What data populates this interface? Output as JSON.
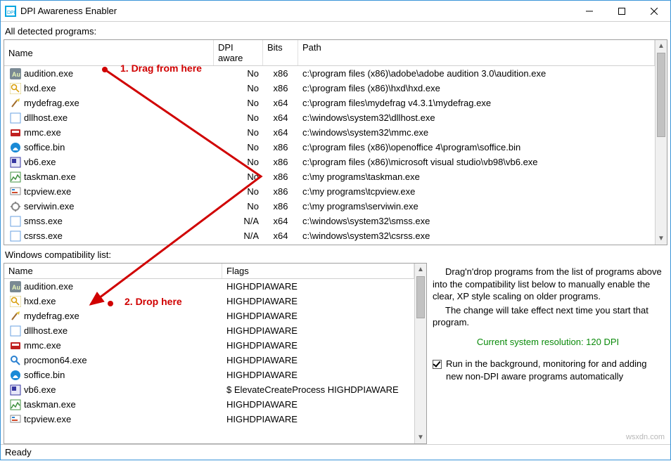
{
  "window": {
    "title": "DPI Awareness Enabler"
  },
  "upper_label": "All detected programs:",
  "upper_headers": {
    "name": "Name",
    "dpi": "DPI aware",
    "bits": "Bits",
    "path": "Path"
  },
  "programs": [
    {
      "icon": "au",
      "name": "audition.exe",
      "dpi": "No",
      "bits": "x86",
      "path": "c:\\program files (x86)\\adobe\\adobe audition 3.0\\audition.exe"
    },
    {
      "icon": "hxd",
      "name": "hxd.exe",
      "dpi": "No",
      "bits": "x86",
      "path": "c:\\program files (x86)\\hxd\\hxd.exe"
    },
    {
      "icon": "broom",
      "name": "mydefrag.exe",
      "dpi": "No",
      "bits": "x64",
      "path": "c:\\program files\\mydefrag v4.3.1\\mydefrag.exe"
    },
    {
      "icon": "blank",
      "name": "dllhost.exe",
      "dpi": "No",
      "bits": "x64",
      "path": "c:\\windows\\system32\\dllhost.exe"
    },
    {
      "icon": "mmc",
      "name": "mmc.exe",
      "dpi": "No",
      "bits": "x64",
      "path": "c:\\windows\\system32\\mmc.exe"
    },
    {
      "icon": "oo",
      "name": "soffice.bin",
      "dpi": "No",
      "bits": "x86",
      "path": "c:\\program files (x86)\\openoffice 4\\program\\soffice.bin"
    },
    {
      "icon": "vb",
      "name": "vb6.exe",
      "dpi": "No",
      "bits": "x86",
      "path": "c:\\program files (x86)\\microsoft visual studio\\vb98\\vb6.exe"
    },
    {
      "icon": "task",
      "name": "taskman.exe",
      "dpi": "No",
      "bits": "x86",
      "path": "c:\\my programs\\taskman.exe"
    },
    {
      "icon": "tcp",
      "name": "tcpview.exe",
      "dpi": "No",
      "bits": "x86",
      "path": "c:\\my programs\\tcpview.exe"
    },
    {
      "icon": "srv",
      "name": "serviwin.exe",
      "dpi": "No",
      "bits": "x86",
      "path": "c:\\my programs\\serviwin.exe"
    },
    {
      "icon": "blank",
      "name": "smss.exe",
      "dpi": "N/A",
      "bits": "x64",
      "path": "c:\\windows\\system32\\smss.exe"
    },
    {
      "icon": "blank",
      "name": "csrss.exe",
      "dpi": "N/A",
      "bits": "x64",
      "path": "c:\\windows\\system32\\csrss.exe"
    }
  ],
  "lower_label": "Windows compatibility list:",
  "lower_headers": {
    "name": "Name",
    "flags": "Flags"
  },
  "compat": [
    {
      "icon": "au",
      "name": "audition.exe",
      "flags": "HIGHDPIAWARE"
    },
    {
      "icon": "hxd",
      "name": "hxd.exe",
      "flags": "HIGHDPIAWARE"
    },
    {
      "icon": "broom",
      "name": "mydefrag.exe",
      "flags": "HIGHDPIAWARE"
    },
    {
      "icon": "blank",
      "name": "dllhost.exe",
      "flags": "HIGHDPIAWARE"
    },
    {
      "icon": "mmc",
      "name": "mmc.exe",
      "flags": "HIGHDPIAWARE"
    },
    {
      "icon": "proc",
      "name": "procmon64.exe",
      "flags": "HIGHDPIAWARE"
    },
    {
      "icon": "oo",
      "name": "soffice.bin",
      "flags": "HIGHDPIAWARE"
    },
    {
      "icon": "vb",
      "name": "vb6.exe",
      "flags": "$ ElevateCreateProcess HIGHDPIAWARE"
    },
    {
      "icon": "task",
      "name": "taskman.exe",
      "flags": "HIGHDPIAWARE"
    },
    {
      "icon": "tcp",
      "name": "tcpview.exe",
      "flags": "HIGHDPIAWARE"
    }
  ],
  "help": {
    "p1": "Drag'n'drop programs from the list of programs above into the compatibility list below to manually enable the clear, XP style scaling on older programs.",
    "p2": "The change will take effect next time you start that program.",
    "resolution": "Current system resolution: 120 DPI",
    "checkbox": "Run in the background, monitoring for and adding new non-DPI aware programs automatically"
  },
  "status": "Ready",
  "annotations": {
    "drag": "1. Drag from here",
    "drop": "2. Drop here"
  },
  "watermark": "wsxdn.com"
}
